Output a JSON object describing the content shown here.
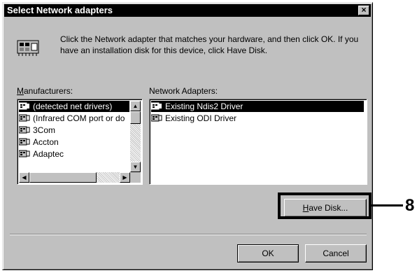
{
  "window": {
    "title": "Select Network adapters",
    "close_label": "×"
  },
  "intro": {
    "text": "Click the Network adapter that matches your hardware, and then click OK. If you have an installation disk for this device, click Have Disk."
  },
  "manufacturers": {
    "label_first": "M",
    "label_rest": "anufacturers:",
    "items": [
      "(detected net drivers)",
      "(Infrared COM port or do",
      "3Com",
      "Accton",
      "Adaptec"
    ],
    "selected_index": 0
  },
  "adapters": {
    "label": "Network Adapters:",
    "items": [
      "Existing Ndis2 Driver",
      "Existing ODI Driver"
    ],
    "selected_index": 0
  },
  "buttons": {
    "have_disk_ul": "H",
    "have_disk_rest": "ave Disk...",
    "ok": "OK",
    "cancel": "Cancel"
  },
  "callout": {
    "number": "8"
  },
  "icons": {
    "adapter": "network-adapter-icon",
    "hardware": "hardware-card-icon"
  }
}
